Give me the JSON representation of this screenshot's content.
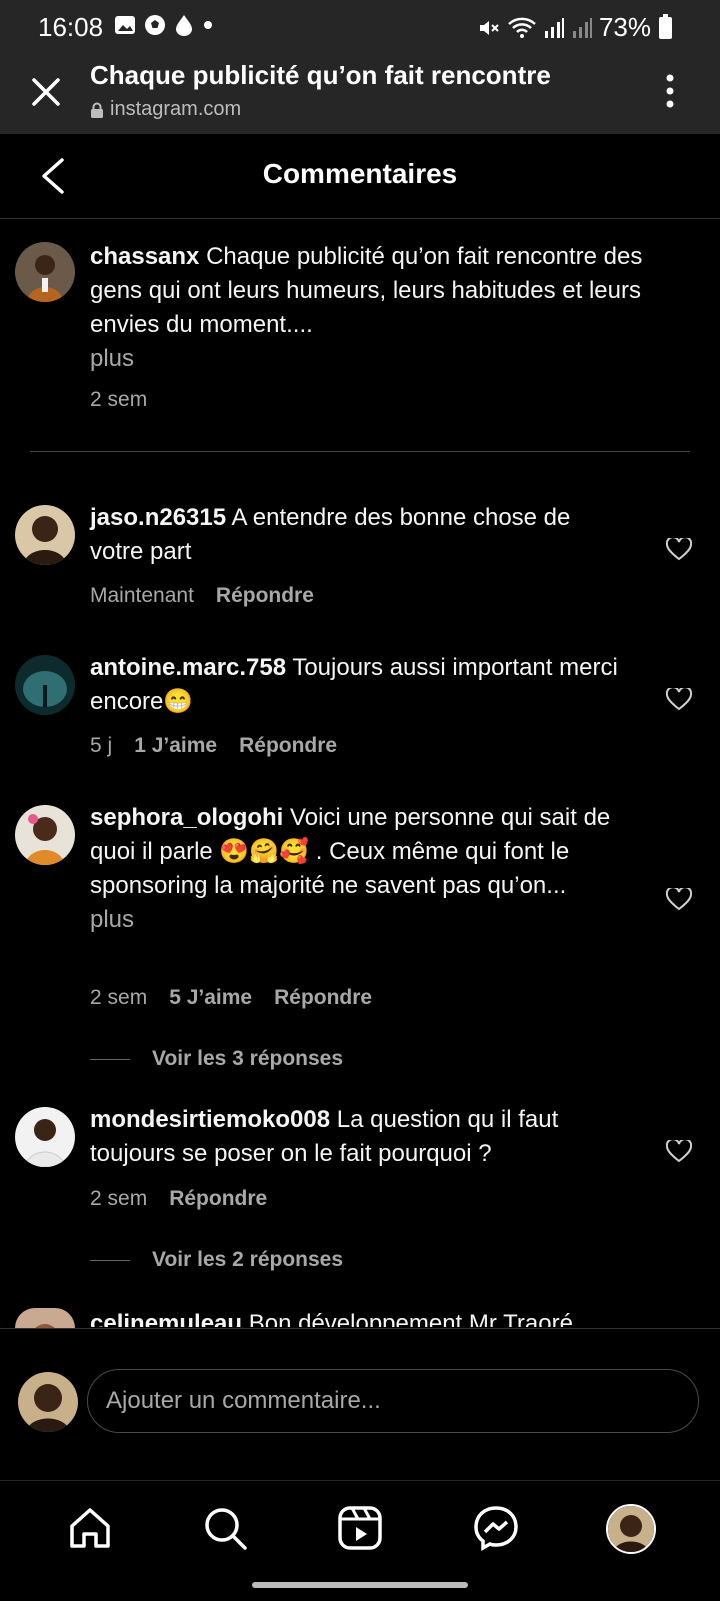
{
  "status_bar": {
    "time": "16:08",
    "battery": "73%"
  },
  "browser": {
    "title": "Chaque publicité qu’on fait rencontre",
    "url": "instagram.com"
  },
  "header": {
    "title": "Commentaires"
  },
  "caption": {
    "username": "chassanx",
    "text": "Chaque publicité qu’on fait rencontre des gens qui ont leurs humeurs, leurs habitudes et leurs envies du moment....",
    "more": "plus",
    "time": "2 sem"
  },
  "comments": [
    {
      "username": "jaso.n26315",
      "text": "A entendre des bonne chose de votre part",
      "time": "Maintenant",
      "reply": "Répondre"
    },
    {
      "username": "antoine.marc.758",
      "text": "Toujours aussi important merci encore😁",
      "time": "5 j",
      "likes": "1 J’aime",
      "reply": "Répondre"
    },
    {
      "username": "sephora_ologohi",
      "text": "Voici une personne qui sait de quoi il parle 😍🤗🥰 . Ceux même qui font le sponsoring la majorité ne savent pas qu’on...",
      "more": "plus",
      "time": "2 sem",
      "likes": "5 J’aime",
      "reply": "Répondre",
      "view_replies": "Voir les 3 réponses"
    },
    {
      "username": "mondesirtiemoko008",
      "text": "La question qu il faut toujours se poser on le fait pourquoi ?",
      "time": "2 sem",
      "reply": "Répondre",
      "view_replies": "Voir les 2 réponses"
    },
    {
      "username": "celinemuleau",
      "text": "Bon développement Mr Traoré"
    }
  ],
  "composer": {
    "placeholder": "Ajouter un commentaire..."
  },
  "nav": [
    "home-icon",
    "search-icon",
    "reels-icon",
    "messenger-icon",
    "profile-avatar"
  ],
  "colors": {
    "background": "#000000",
    "secondary_text": "#a8a8a8",
    "topbar": "#262626"
  }
}
